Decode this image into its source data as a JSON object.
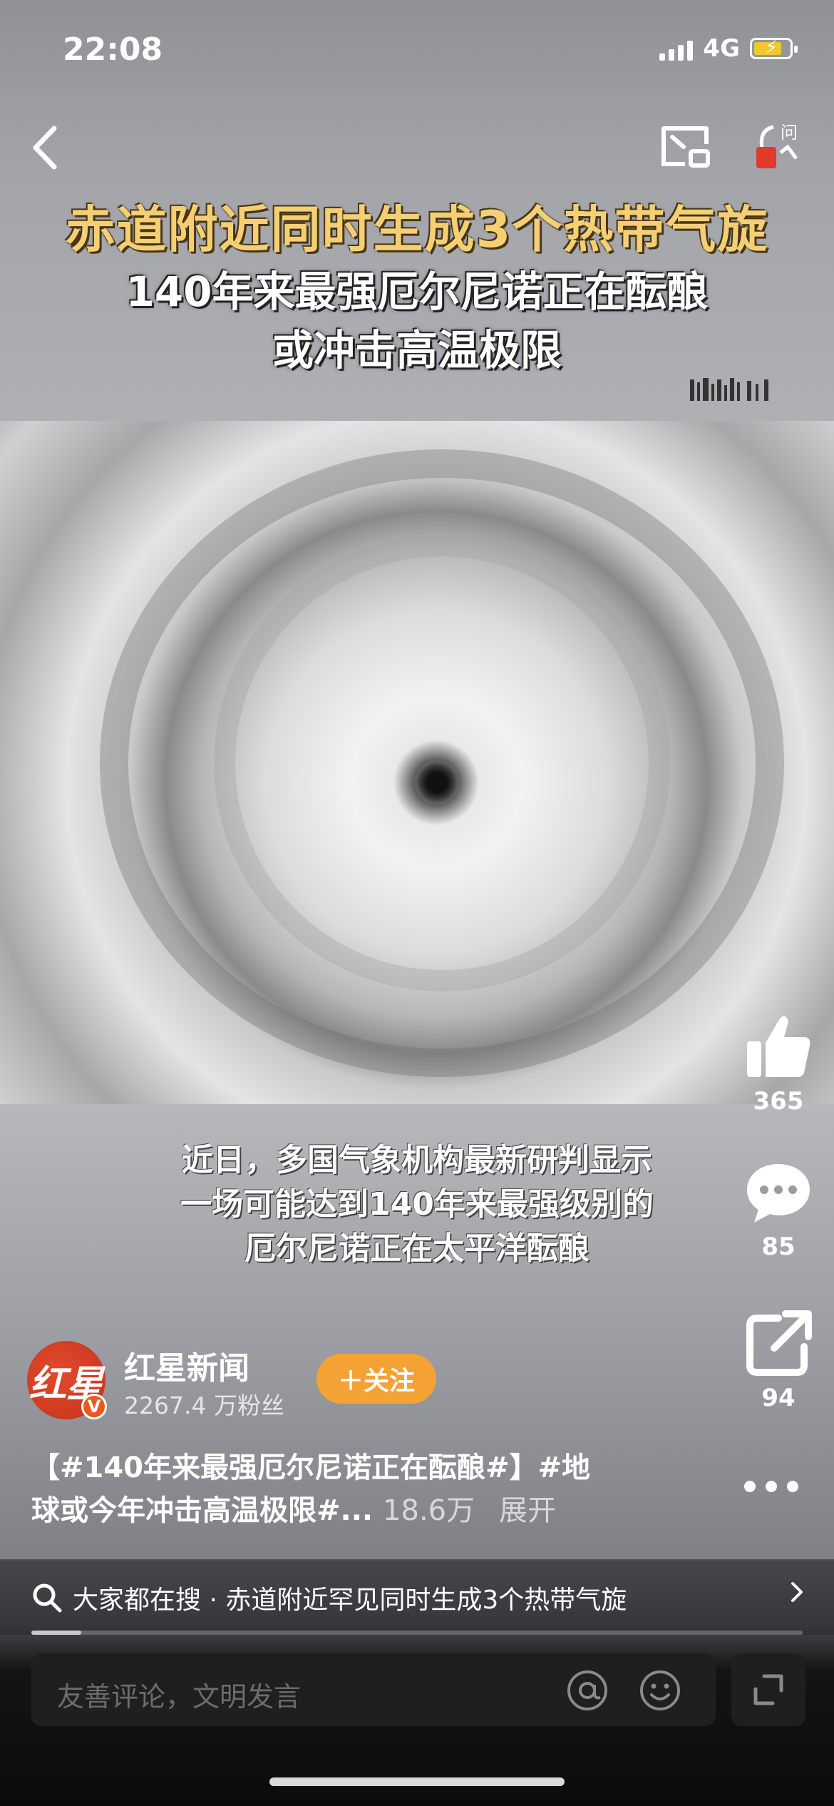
{
  "status_bar": {
    "time": "22:08",
    "network": "4G"
  },
  "video": {
    "title": "赤道附近同时生成3个热带气旋",
    "headline_line1": "140年来最强厄尔尼诺正在酝酿",
    "headline_line2": "或冲击高温极限",
    "subtitle_line1": "近日，多国气象机构最新研判显示",
    "subtitle_line2": "一场可能达到140年来最强级别的",
    "subtitle_line3": "厄尔尼诺正在太平洋酝酿",
    "progress_fraction": 0.065
  },
  "actions": {
    "like_count": "365",
    "comment_count": "85",
    "share_count": "94"
  },
  "account": {
    "name": "红星新闻",
    "followers": "2267.4 万粉丝",
    "follow_label": "＋关注",
    "avatar_text": "红星",
    "avatar_badge": "V"
  },
  "description": {
    "text_line1": "【#140年来最强厄尔尼诺正在酝酿#】#地",
    "text_line2": "球或今年冲击高温极限#...",
    "views": "18.6万",
    "expand_label": "展开"
  },
  "search_suggestion": {
    "text": "大家都在搜 · 赤道附近罕见同时生成3个热带气旋"
  },
  "comment_input": {
    "placeholder": "友善评论，文明发言"
  },
  "icons": [
    "back-icon",
    "cast-icon",
    "ask-icon",
    "like-icon",
    "comment-icon",
    "share-icon",
    "more-icon",
    "search-icon",
    "at-icon",
    "emoji-icon",
    "fullscreen-icon"
  ],
  "colors": {
    "follow_button": "#f5a234",
    "title_gold": "#f5cf74",
    "avatar_red": "#d8402a"
  }
}
